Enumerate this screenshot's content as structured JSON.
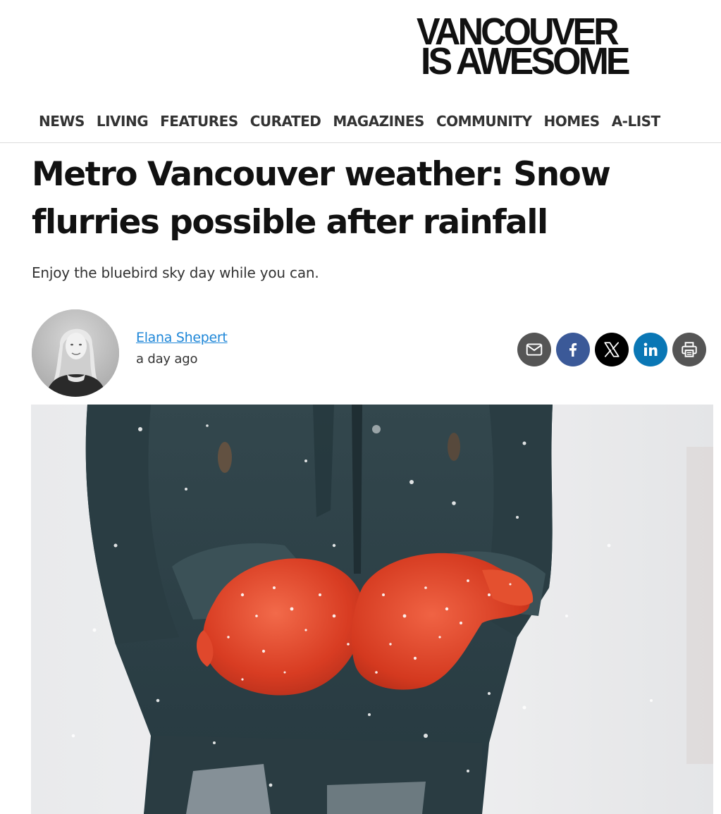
{
  "site": {
    "logo_line1": "VANCOUVER",
    "logo_line2": "IS AWESOME"
  },
  "nav": {
    "items": [
      {
        "label": "NEWS"
      },
      {
        "label": "LIVING"
      },
      {
        "label": "FEATURES"
      },
      {
        "label": "CURATED"
      },
      {
        "label": "MAGAZINES"
      },
      {
        "label": "COMMUNITY"
      },
      {
        "label": "HOMES"
      },
      {
        "label": "A-LIST"
      }
    ]
  },
  "article": {
    "headline": "Metro Vancouver weather: Snow flurries possible after rainfall",
    "dek": "Enjoy the bluebird sky day while you can.",
    "author": "Elana Shepert",
    "timestamp": "a day ago"
  },
  "share": {
    "buttons": [
      {
        "icon": "email-icon",
        "color": "#555555"
      },
      {
        "icon": "facebook-icon",
        "color": "#3b5998"
      },
      {
        "icon": "x-icon",
        "color": "#000000"
      },
      {
        "icon": "linkedin-icon",
        "color": "#0a77b5"
      },
      {
        "icon": "print-icon",
        "color": "#555555"
      }
    ]
  },
  "colors": {
    "link": "#1f87d8",
    "mitten": "#e0442a",
    "coat": "#2c4147"
  }
}
